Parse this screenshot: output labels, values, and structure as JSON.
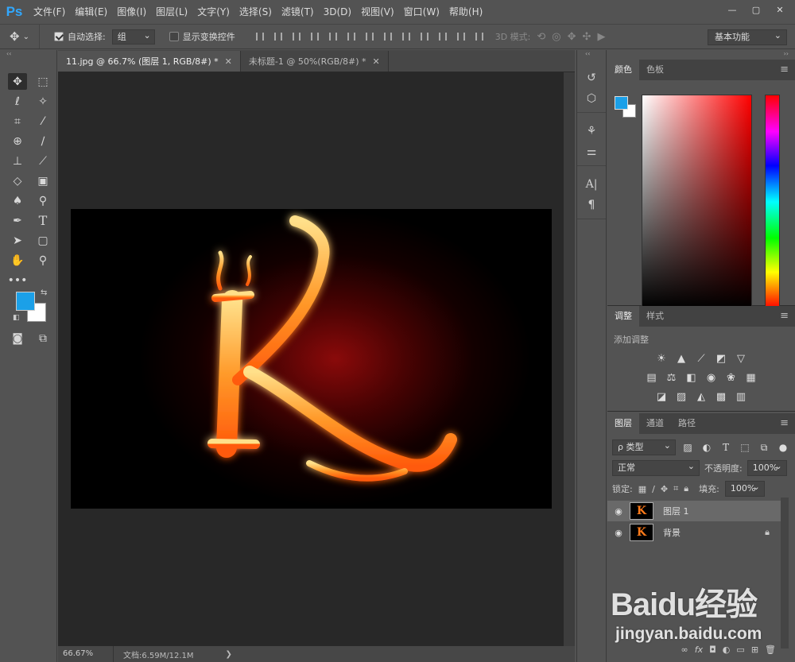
{
  "app": {
    "logo": "Ps"
  },
  "menu": [
    "文件(F)",
    "编辑(E)",
    "图像(I)",
    "图层(L)",
    "文字(Y)",
    "选择(S)",
    "滤镜(T)",
    "3D(D)",
    "视图(V)",
    "窗口(W)",
    "帮助(H)"
  ],
  "window_controls": [
    "—",
    "▢",
    "✕"
  ],
  "options": {
    "auto_select_label": "自动选择:",
    "auto_select_value": "组",
    "show_transform_label": "显示变换控件",
    "mode_3d_label": "3D 模式:",
    "workspace": "基本功能"
  },
  "tabs": [
    {
      "label": "11.jpg @ 66.7% (图层 1, RGB/8#) *",
      "close": "✕"
    },
    {
      "label": "未标题-1 @ 50%(RGB/8#) *",
      "close": "✕"
    }
  ],
  "status": {
    "zoom": "66.67%",
    "doc": "文档:6.59M/12.1M",
    "arrow": "❯"
  },
  "colors": {
    "foreground": "#1ba0e8",
    "background": "#ffffff"
  },
  "panels": {
    "color_tabs": [
      "颜色",
      "色板"
    ],
    "adjust_tabs": [
      "调整",
      "样式"
    ],
    "adjust_add": "添加调整",
    "layers_tabs": [
      "图层",
      "通道",
      "路径"
    ],
    "layer_filter": "ρ 类型",
    "blend_mode": "正常",
    "opacity_label": "不透明度:",
    "opacity_value": "100%",
    "lock_label": "锁定:",
    "fill_label": "填充:",
    "fill_value": "100%",
    "menu_glyph": "≡"
  },
  "layers": [
    {
      "name": "图层 1",
      "selected": true
    },
    {
      "name": "背景",
      "selected": false
    }
  ],
  "watermark": {
    "brand": "Baidu经验",
    "url": "jingyan.baidu.com"
  }
}
